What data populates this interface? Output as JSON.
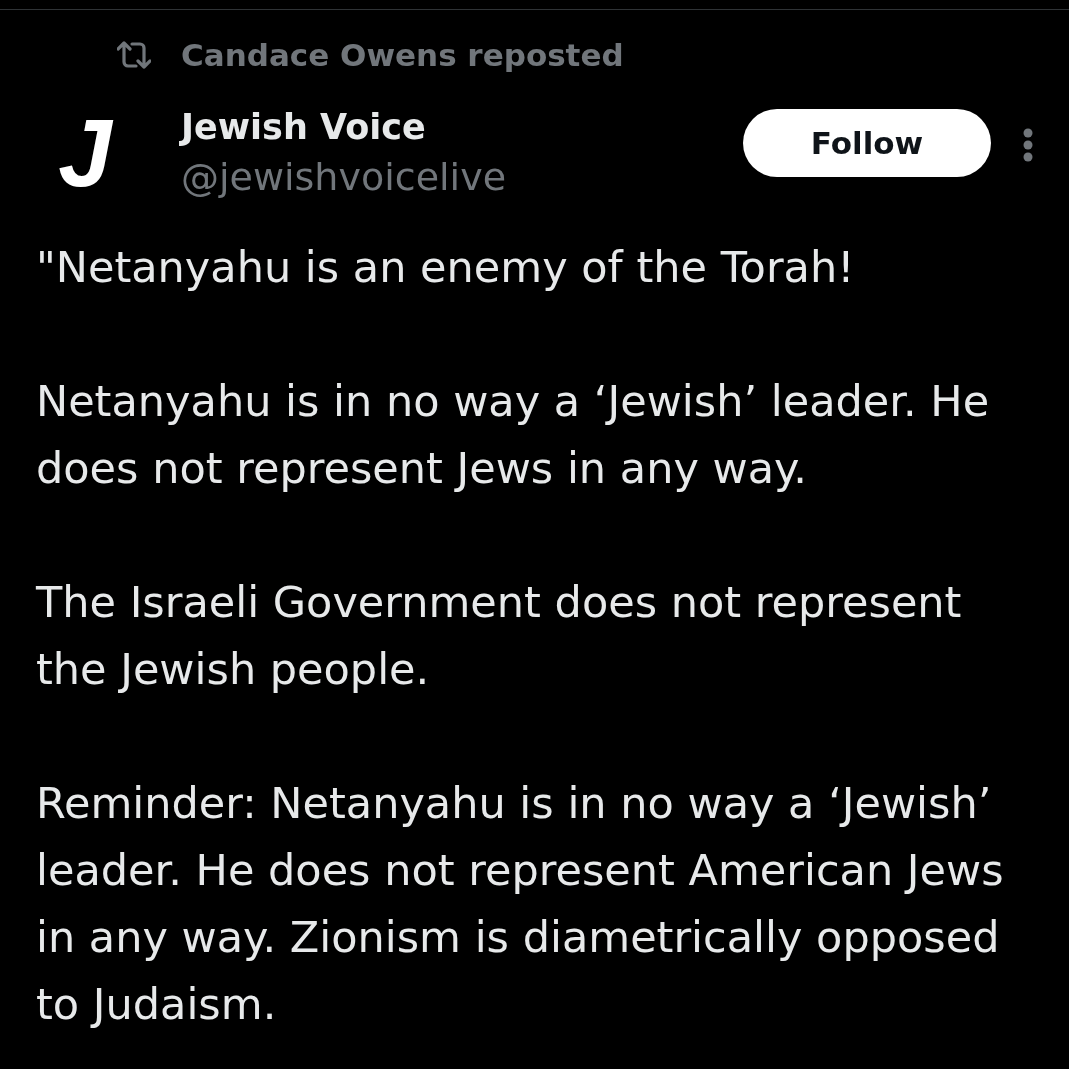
{
  "repost": {
    "label": "Candace Owens reposted"
  },
  "author": {
    "avatar_letter": "J",
    "name": "Jewish Voice",
    "handle": "@jewishvoicelive"
  },
  "follow_button": {
    "label": "Follow"
  },
  "body": [
    "\"Netanyahu is an enemy of the Torah!",
    "Netanyahu is in no way a ‘Jewish’ leader. He does not represent Jews in any way.",
    "The Israeli Government does not represent the Jewish people.",
    "Reminder: Netanyahu is in no way a ‘Jewish’ leader. He does not represent American Jews in any way. Zionism is diametrically opposed to Judaism."
  ]
}
